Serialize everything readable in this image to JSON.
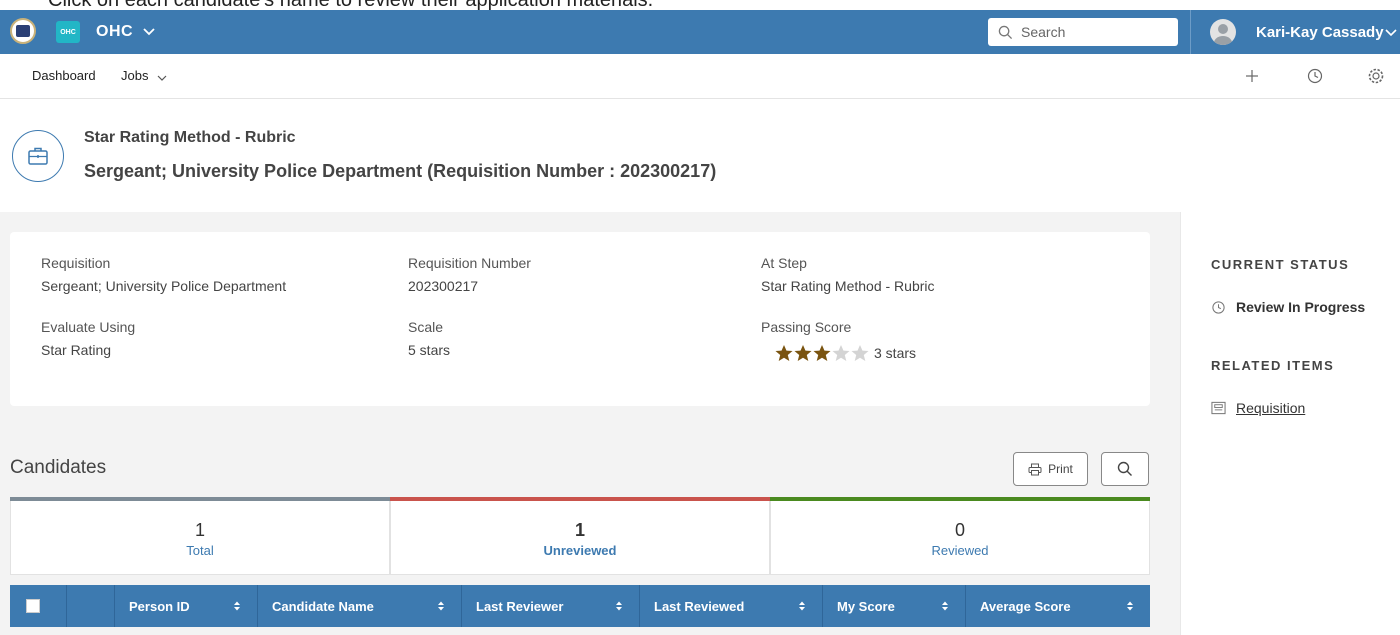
{
  "cutoff_text": "Click on each candidate's name to review their application materials.",
  "header": {
    "app_tile": "OHC",
    "app_name": "OHC",
    "search_placeholder": "Search",
    "user_name": "Kari-Kay Cassady"
  },
  "nav": {
    "dashboard": "Dashboard",
    "jobs": "Jobs"
  },
  "page": {
    "title": "Star Rating Method - Rubric",
    "subtitle": "Sergeant; University Police Department (Requisition Number : 202300217)"
  },
  "details": {
    "requisition_label": "Requisition",
    "requisition_value": "Sergeant; University Police Department",
    "req_number_label": "Requisition Number",
    "req_number_value": "202300217",
    "at_step_label": "At Step",
    "at_step_value": "Star Rating Method - Rubric",
    "evaluate_label": "Evaluate Using",
    "evaluate_value": "Star Rating",
    "scale_label": "Scale",
    "scale_value": "5 stars",
    "passing_label": "Passing Score",
    "passing_value": "3 stars",
    "passing_stars": 3,
    "scale_stars": 5
  },
  "candidates": {
    "title": "Candidates",
    "print_label": "Print",
    "stats": [
      {
        "count": "1",
        "label": "Total",
        "color": "#7d8b96"
      },
      {
        "count": "1",
        "label": "Unreviewed",
        "color": "#c9534c"
      },
      {
        "count": "0",
        "label": "Reviewed",
        "color": "#4a8a1f"
      }
    ],
    "columns": [
      "Person ID",
      "Candidate Name",
      "Last Reviewer",
      "Last Reviewed",
      "My Score",
      "Average Score"
    ]
  },
  "sidebar": {
    "status_heading": "CURRENT STATUS",
    "status_value": "Review In Progress",
    "related_heading": "RELATED ITEMS",
    "related_link": "Requisition"
  },
  "colors": {
    "primary": "#3d7ab0",
    "star_filled": "#7a5410",
    "star_empty": "#d4d4d4"
  }
}
